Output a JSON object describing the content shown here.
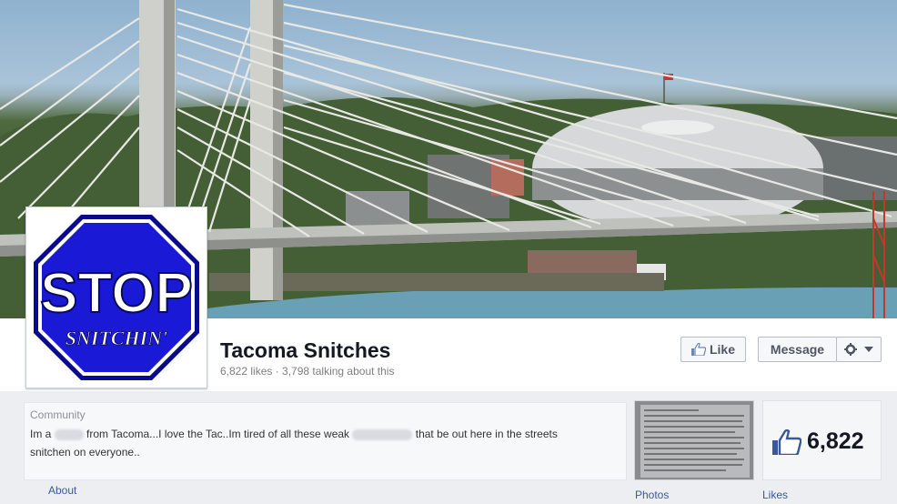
{
  "page": {
    "name": "Tacoma Snitches",
    "stats": "6,822 likes · 3,798 talking about this"
  },
  "profile_sign": {
    "top_text": "STOP",
    "bottom_text": "SNITCHIN'"
  },
  "actions": {
    "like_label": "Like",
    "message_label": "Message"
  },
  "about": {
    "category": "Community",
    "text_part1": "Im a",
    "text_part2": "from Tacoma...I love the Tac..Im tired of all these weak",
    "text_part3": "that be out here in the streets",
    "text_part4": "snitchen on everyone.."
  },
  "likes_box": {
    "count": "6,822"
  },
  "tabs": {
    "about": "About",
    "photos": "Photos",
    "likes": "Likes"
  },
  "colors": {
    "link": "#3b5998",
    "sign_blue": "#1a1ad6"
  },
  "icons": {
    "like_button": "thumbs-up-icon",
    "settings": "gear-icon",
    "dropdown": "caret-down-icon",
    "likes_box": "thumbs-up-icon"
  }
}
